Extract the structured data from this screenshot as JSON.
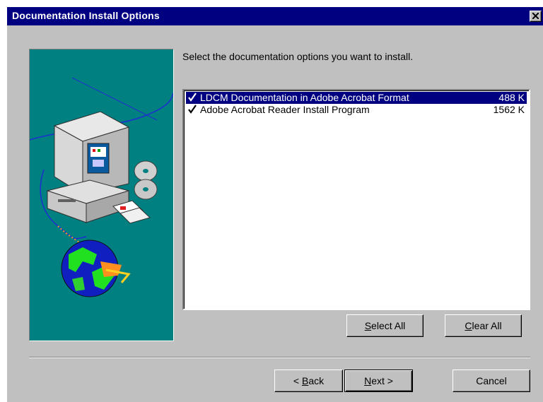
{
  "window": {
    "title": "Documentation Install Options"
  },
  "instruction": "Select the documentation options you want to install.",
  "options": [
    {
      "label": "LDCM Documentation in Adobe Acrobat Format",
      "size": "488 K",
      "checked": true,
      "selected": true
    },
    {
      "label": "Adobe Acrobat Reader Install Program",
      "size": "1562 K",
      "checked": true,
      "selected": false
    }
  ],
  "buttons": {
    "select_all": {
      "mnemonic": "S",
      "rest": "elect All"
    },
    "clear_all": {
      "mnemonic": "C",
      "rest": "lear All"
    },
    "back": {
      "prefix": "< ",
      "mnemonic": "B",
      "rest": "ack"
    },
    "next": {
      "mnemonic": "N",
      "rest": "ext >"
    },
    "cancel": "Cancel"
  },
  "colors": {
    "title_bar": "#000080",
    "dialog_face": "#c0c0c0",
    "art_background": "#008080",
    "selection": "#000080"
  }
}
